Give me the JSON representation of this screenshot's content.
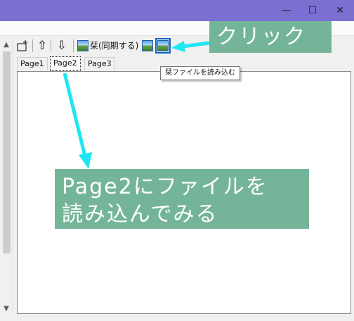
{
  "window": {
    "minimize_glyph": "—",
    "maximize_glyph": "☐",
    "close_glyph": "✕"
  },
  "toolbar": {
    "up_glyph": "⇧",
    "down_glyph": "⇩",
    "sync_label": "栞(同期する)"
  },
  "tabs": [
    {
      "label": "Page1",
      "selected": false
    },
    {
      "label": "Page2",
      "selected": true
    },
    {
      "label": "Page3",
      "selected": false
    }
  ],
  "tooltip": "栞ファイルを読み込む",
  "scrollbar": {
    "up_glyph": "▲",
    "down_glyph": "▼"
  },
  "annotations": {
    "click_label": "クリック",
    "main_line1": "Page2にファイルを",
    "main_line2": "読み込んでみる",
    "color": "#74b59a",
    "arrow_color": "#1de7f0"
  }
}
